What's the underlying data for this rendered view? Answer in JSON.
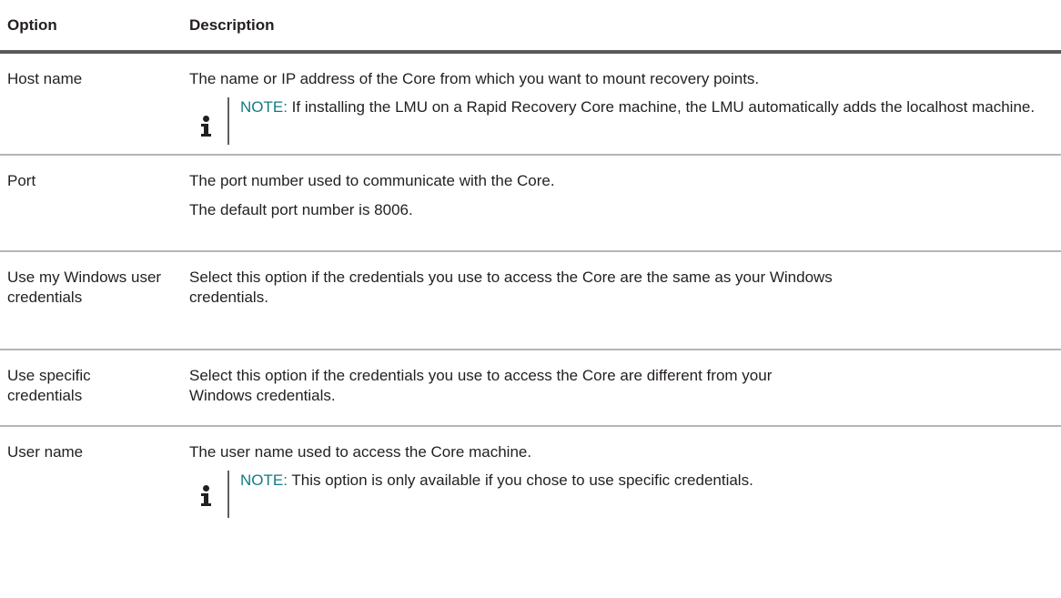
{
  "header": {
    "option": "Option",
    "description": "Description"
  },
  "rows": [
    {
      "option": "Host name",
      "description": "The name or IP address of the Core from which you want to mount recovery points.",
      "note": {
        "label": "NOTE:",
        "text": " If installing the LMU on a Rapid Recovery Core machine, the LMU automatically adds the localhost machine."
      }
    },
    {
      "option": "Port",
      "description": "The port number used to communicate with the Core.",
      "description2": "The default port number is 8006."
    },
    {
      "option": "Use my Windows user credentials",
      "description": "Select this option if the credentials you use to access the Core are the same as your Windows credentials."
    },
    {
      "option": "Use specific credentials",
      "description": "Select this option if the credentials you use to access the Core are different from your Windows credentials."
    },
    {
      "option": "User name",
      "description": "The user name used to access the Core machine.",
      "note": {
        "label": "NOTE:",
        "text": " This option is only available if you chose to use specific credentials."
      }
    }
  ],
  "icons": {
    "note": "info-icon"
  },
  "colors": {
    "note_label": "#127a85",
    "header_rule": "#5a5a5a",
    "row_rule": "#b5b5b5"
  }
}
